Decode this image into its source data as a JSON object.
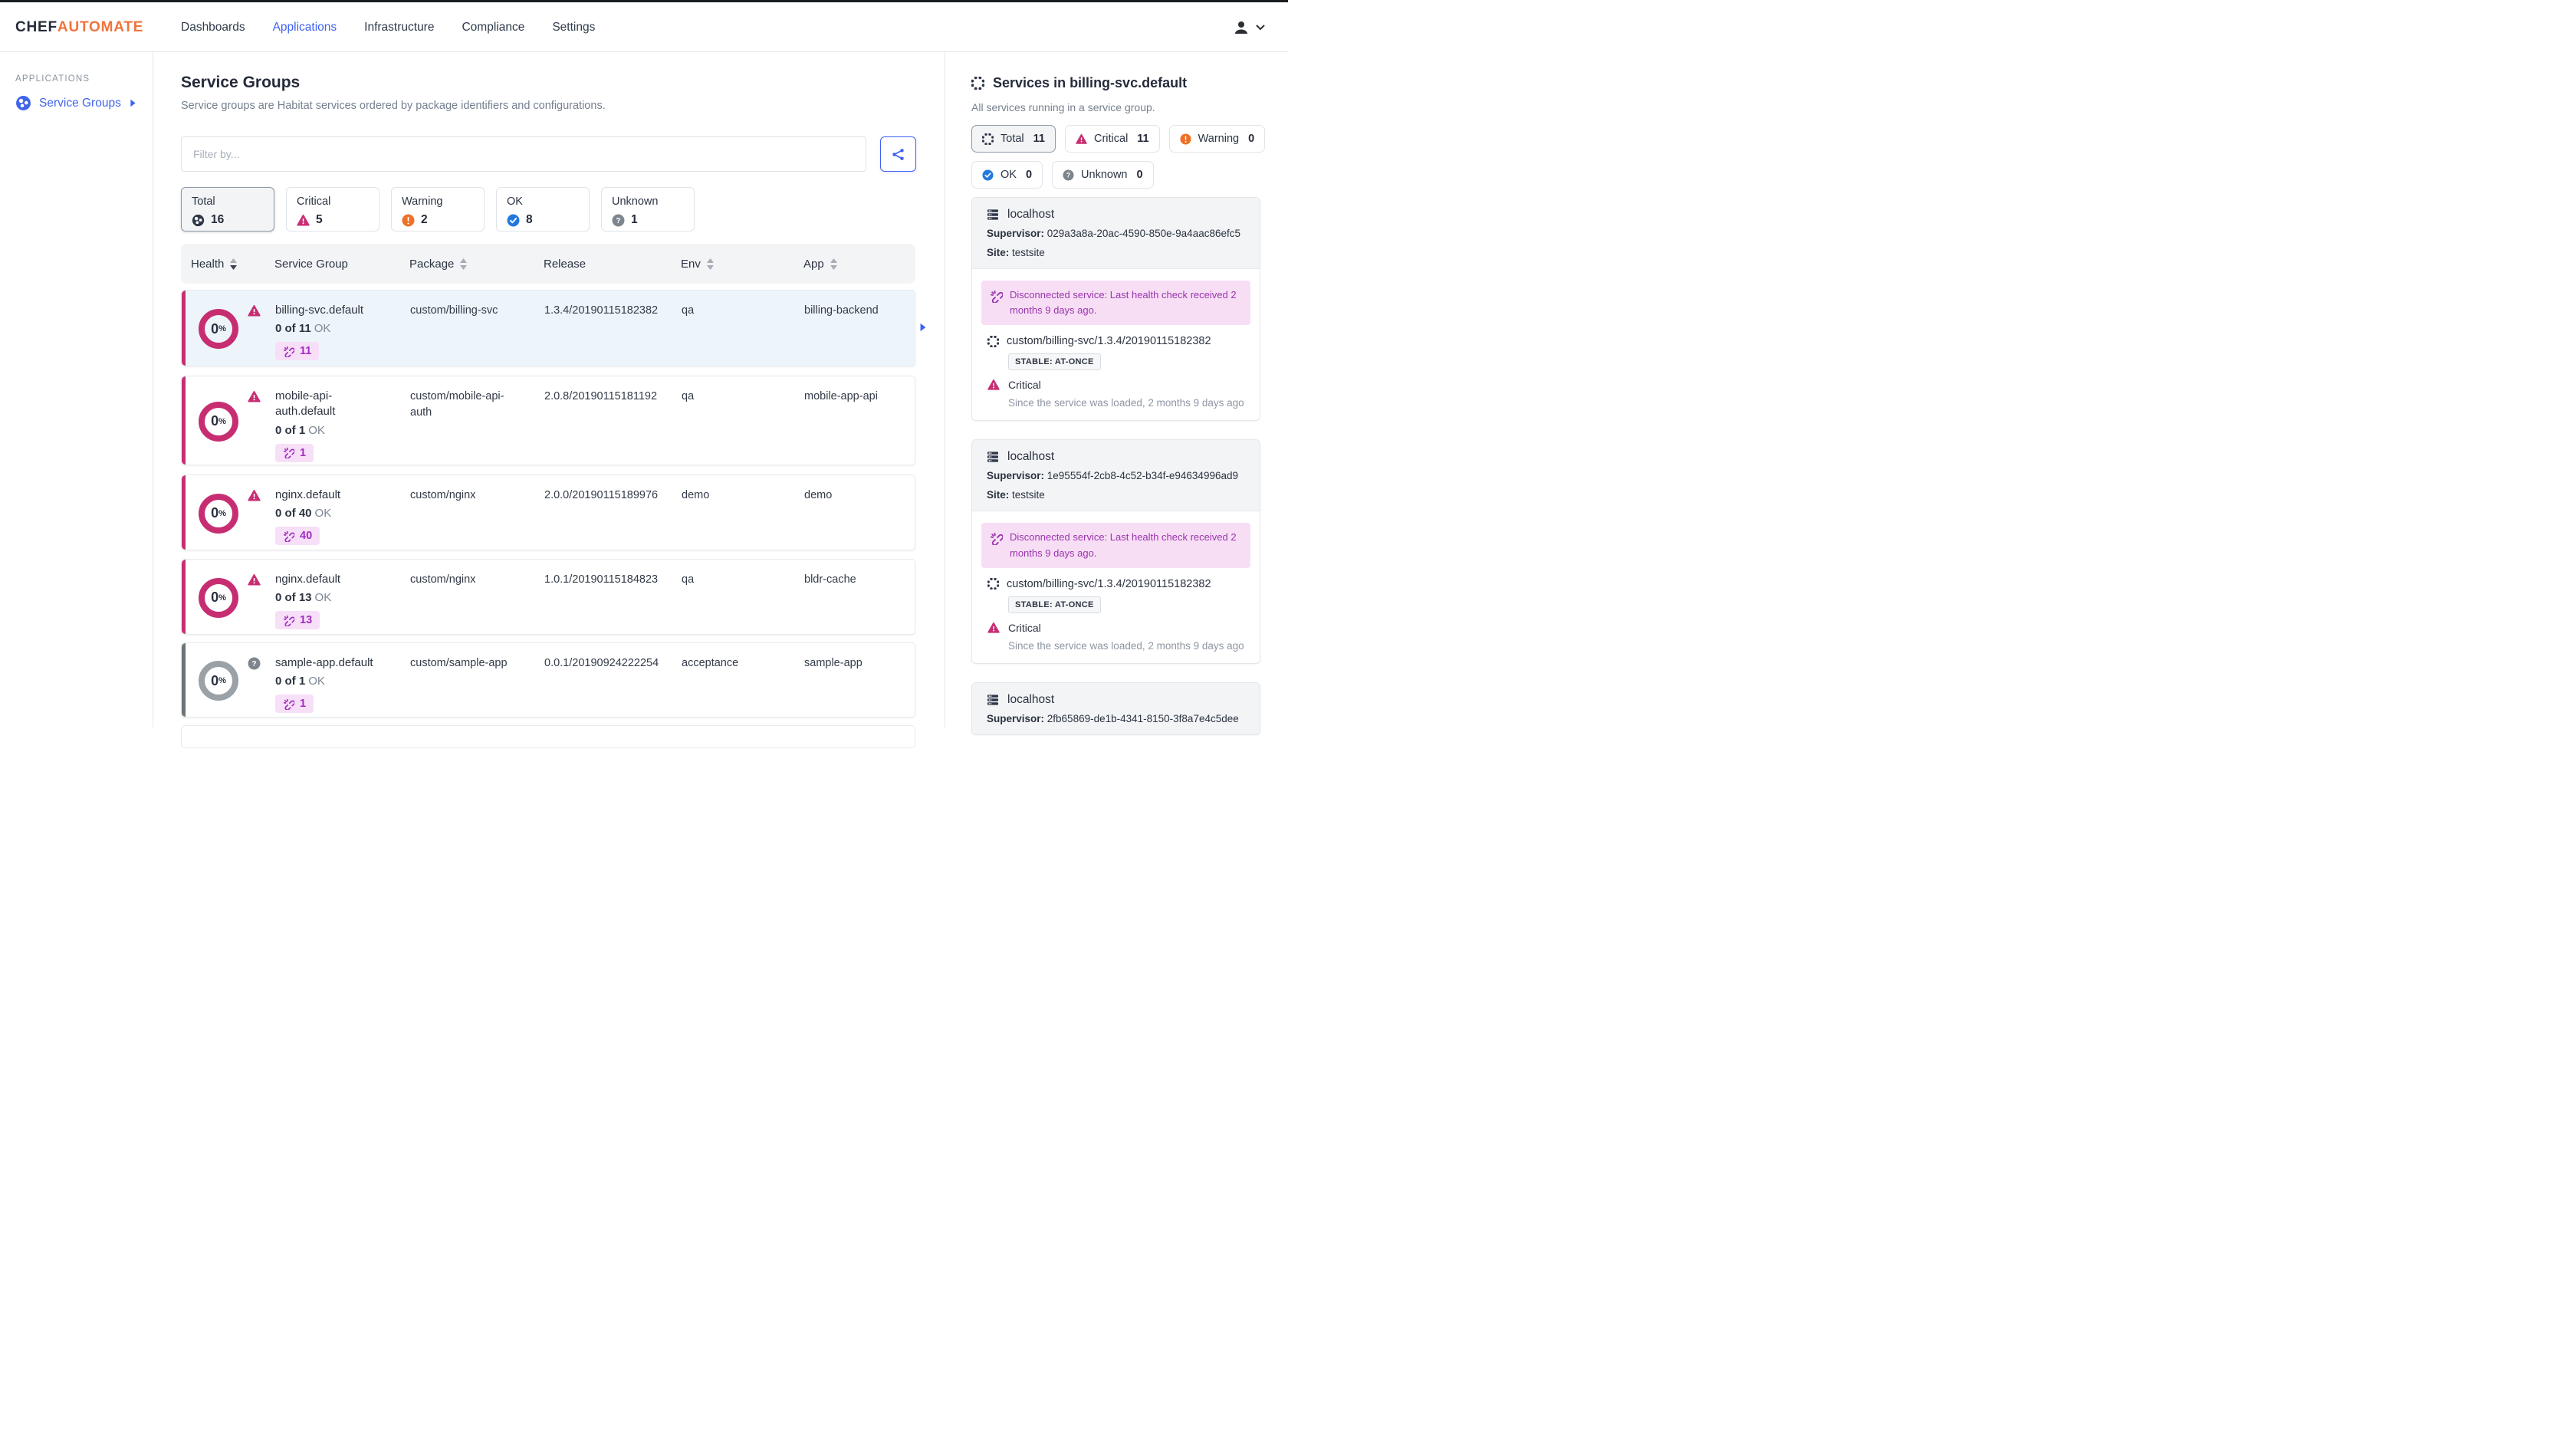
{
  "colors": {
    "accent_blue": "#3f62f2",
    "logo_orange": "#f0743c",
    "critical_pink": "#c72e72",
    "warning_orange": "#ee7125",
    "ok_blue": "#2278dd",
    "unknown_gray": "#7d858d",
    "unknown_accent": "#6b7376",
    "purple": "#9c31b5",
    "dark_icon": "#2e3648"
  },
  "nav": {
    "logo_part1": "CHEF",
    "logo_part2": "AUTOMATE",
    "items": [
      {
        "label": "Dashboards",
        "active": false
      },
      {
        "label": "Applications",
        "active": true
      },
      {
        "label": "Infrastructure",
        "active": false
      },
      {
        "label": "Compliance",
        "active": false
      },
      {
        "label": "Settings",
        "active": false
      }
    ]
  },
  "sidebar": {
    "heading": "APPLICATIONS",
    "items": [
      {
        "label": "Service Groups",
        "active": true
      }
    ]
  },
  "main": {
    "title": "Service Groups",
    "subtitle": "Service groups are Habitat services ordered by package identifiers and configurations.",
    "filter_placeholder": "Filter by...",
    "stats": [
      {
        "label": "Total",
        "count": "16",
        "state": "total",
        "active": true
      },
      {
        "label": "Critical",
        "count": "5",
        "state": "critical",
        "active": false
      },
      {
        "label": "Warning",
        "count": "2",
        "state": "warning",
        "active": false
      },
      {
        "label": "OK",
        "count": "8",
        "state": "ok",
        "active": false
      },
      {
        "label": "Unknown",
        "count": "1",
        "state": "unknown",
        "active": false
      }
    ],
    "table": {
      "columns": [
        {
          "label": "Health",
          "sort": "desc"
        },
        {
          "label": "Service Group",
          "sort": null
        },
        {
          "label": "Package",
          "sort": "none"
        },
        {
          "label": "Release",
          "sort": null
        },
        {
          "label": "Env",
          "sort": "none"
        },
        {
          "label": "App",
          "sort": "none"
        }
      ],
      "rows": [
        {
          "health_pct": "0",
          "state": "critical",
          "selected": true,
          "name": "billing-svc.default",
          "ok_count": "0 of 11",
          "ok_text": "OK",
          "badge": "11",
          "package": "custom/billing-svc",
          "release": "1.3.4/20190115182382",
          "env": "qa",
          "app": "billing-backend"
        },
        {
          "health_pct": "0",
          "state": "critical",
          "selected": false,
          "name": "mobile-api-auth.default",
          "ok_count": "0 of 1",
          "ok_text": "OK",
          "badge": "1",
          "package": "custom/mobile-api-auth",
          "release": "2.0.8/20190115181192",
          "env": "qa",
          "app": "mobile-app-api"
        },
        {
          "health_pct": "0",
          "state": "critical",
          "selected": false,
          "name": "nginx.default",
          "ok_count": "0 of 40",
          "ok_text": "OK",
          "badge": "40",
          "package": "custom/nginx",
          "release": "2.0.0/20190115189976",
          "env": "demo",
          "app": "demo"
        },
        {
          "health_pct": "0",
          "state": "critical",
          "selected": false,
          "name": "nginx.default",
          "ok_count": "0 of 13",
          "ok_text": "OK",
          "badge": "13",
          "package": "custom/nginx",
          "release": "1.0.1/20190115184823",
          "env": "qa",
          "app": "bldr-cache"
        },
        {
          "health_pct": "0",
          "state": "unknown",
          "selected": false,
          "name": "sample-app.default",
          "ok_count": "0 of 1",
          "ok_text": "OK",
          "badge": "1",
          "package": "custom/sample-app",
          "release": "0.0.1/20190924222254",
          "env": "acceptance",
          "app": "sample-app"
        }
      ]
    }
  },
  "panel": {
    "title": "Services in billing-svc.default",
    "subtitle": "All services running in a service group.",
    "supervisor_label": "Supervisor:",
    "site_label": "Site:",
    "stats": [
      {
        "label": "Total",
        "count": "11",
        "state": "total",
        "active": true
      },
      {
        "label": "Critical",
        "count": "11",
        "state": "critical",
        "active": false
      },
      {
        "label": "Warning",
        "count": "0",
        "state": "warning",
        "active": false
      },
      {
        "label": "OK",
        "count": "0",
        "state": "ok",
        "active": false
      },
      {
        "label": "Unknown",
        "count": "0",
        "state": "unknown",
        "active": false
      }
    ],
    "cards": [
      {
        "host": "localhost",
        "supervisor": "029a3a8a-20ac-4590-850e-9a4aac86efc5",
        "site": "testsite",
        "alert": "Disconnected service: Last health check received 2 months 9 days ago.",
        "package": "custom/billing-svc/1.3.4/20190115182382",
        "chip": "STABLE: AT-ONCE",
        "status": "Critical",
        "since": "Since the service was loaded, 2 months 9 days ago"
      },
      {
        "host": "localhost",
        "supervisor": "1e95554f-2cb8-4c52-b34f-e94634996ad9",
        "site": "testsite",
        "alert": "Disconnected service: Last health check received 2 months 9 days ago.",
        "package": "custom/billing-svc/1.3.4/20190115182382",
        "chip": "STABLE: AT-ONCE",
        "status": "Critical",
        "since": "Since the service was loaded, 2 months 9 days ago"
      },
      {
        "host": "localhost",
        "supervisor": "2fb65869-de1b-4341-8150-3f8a7e4c5dee"
      }
    ]
  }
}
